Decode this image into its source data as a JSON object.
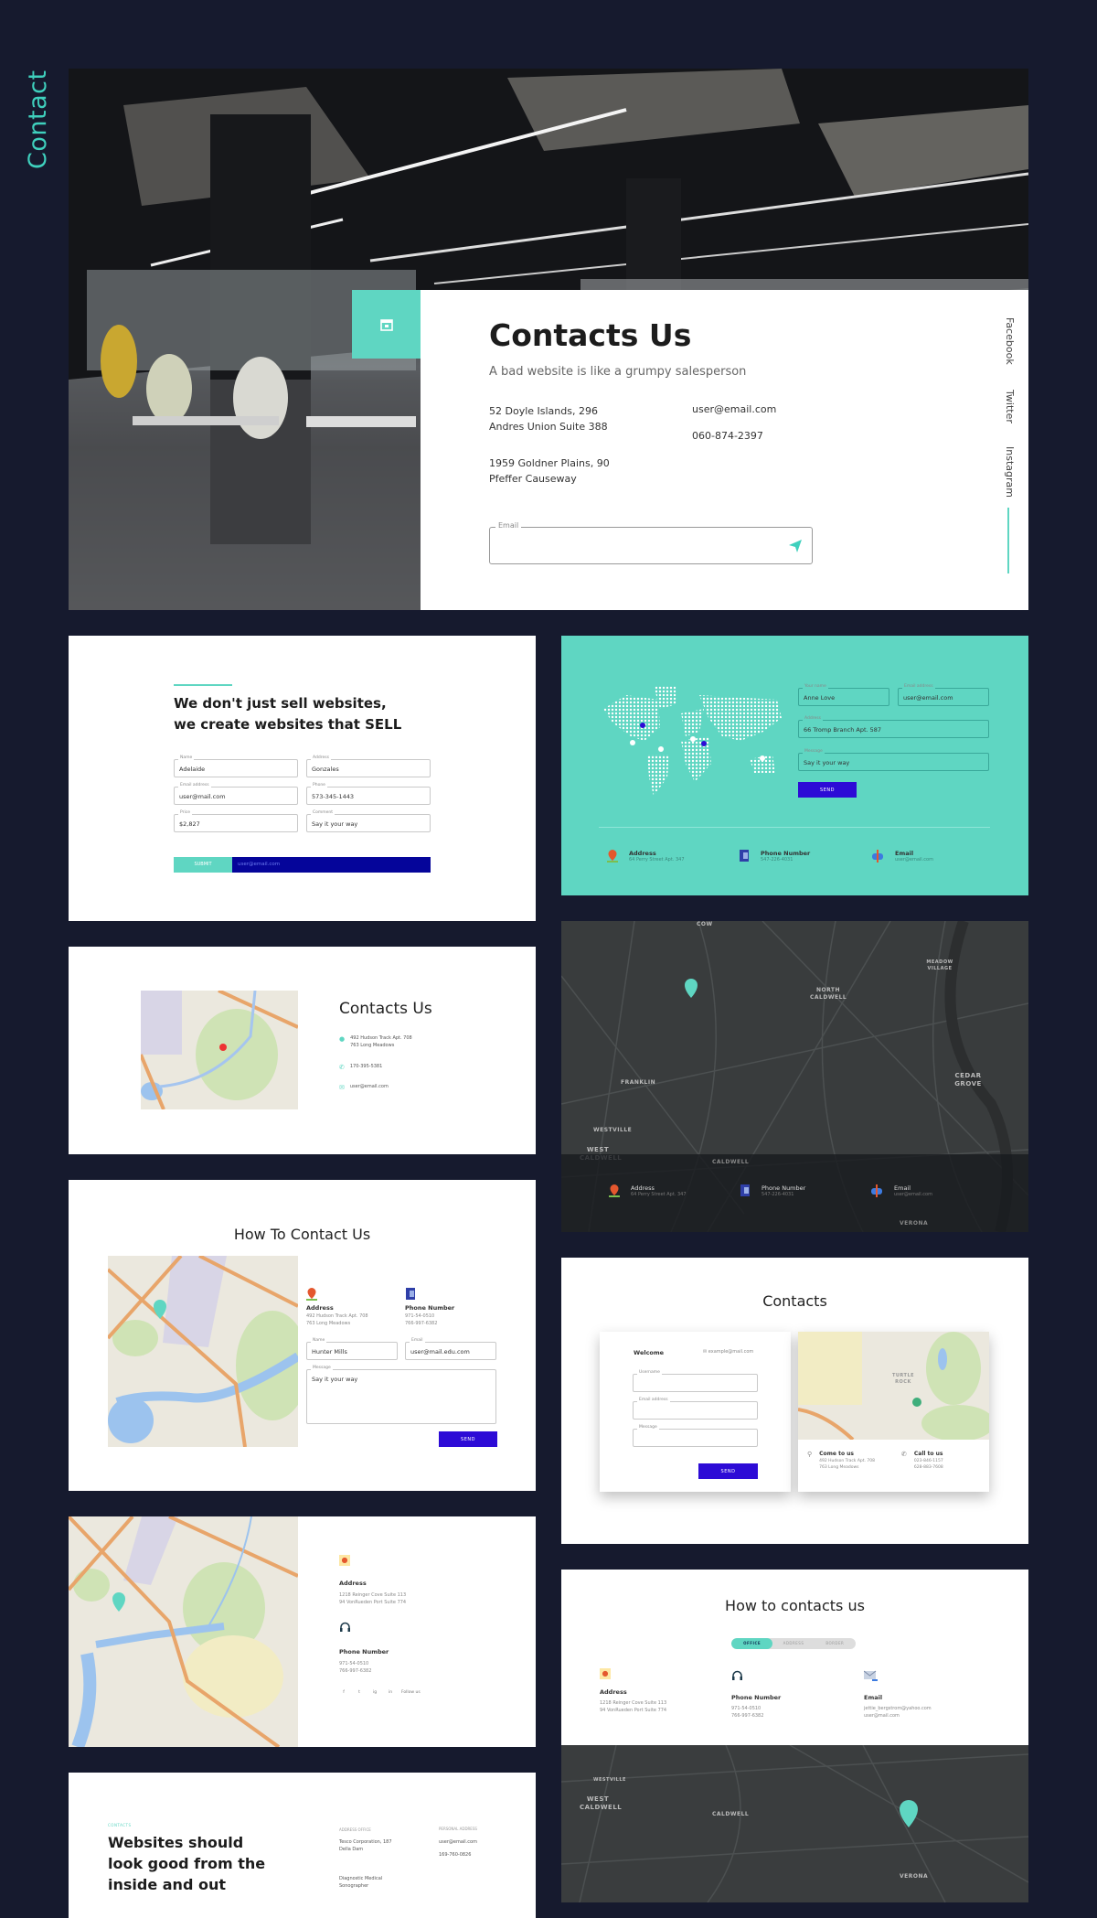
{
  "section_title": "Contact",
  "colors": {
    "background": "#161a2e",
    "accent_teal": "#5fd6c2",
    "button_blue": "#2d0bd6",
    "navy": "#05059a"
  },
  "hero": {
    "icon": "calendar-icon",
    "title": "Contacts Us",
    "subtitle": "A bad website is like a grumpy salesperson",
    "address1": [
      "52 Doyle Islands, 296",
      "Andres Union Suite 388"
    ],
    "address2": [
      "1959 Goldner Plains, 90",
      "Pfeffer Causeway"
    ],
    "email": "user@email.com",
    "phone": "060-874-2397",
    "email_field_label": "Email",
    "send_icon": "paper-plane-icon",
    "social": [
      "Facebook",
      "Twitter",
      "Instagram"
    ]
  },
  "sell": {
    "heading": "We don't just sell websites, we create websites that SELL",
    "fields": [
      {
        "label": "Name",
        "value": "Adelaide"
      },
      {
        "label": "Address",
        "value": "Gonzales"
      },
      {
        "label": "Email address",
        "value": "user@mail.com"
      },
      {
        "label": "Phone",
        "value": "573-345-1443"
      },
      {
        "label": "Price",
        "value": "$2,827"
      },
      {
        "label": "Comment",
        "value": "Say it your way"
      }
    ],
    "submit": "SUBMIT",
    "email_value": "user@email.com"
  },
  "teal": {
    "fields": [
      {
        "label": "Your name",
        "value": "Anne Love"
      },
      {
        "label": "Email address",
        "value": "user@email.com"
      },
      {
        "label": "Address",
        "value": "66 Tromp Branch Apt. 587"
      },
      {
        "label": "Message",
        "value": "Say it your way"
      }
    ],
    "send": "SEND",
    "info": [
      {
        "icon": "map-pin-icon",
        "label": "Address",
        "value": "64 Perry Street Apt. 347"
      },
      {
        "icon": "phone-icon",
        "label": "Phone Number",
        "value": "547-226-4031"
      },
      {
        "icon": "mailbox-icon",
        "label": "Email",
        "value": "user@email.com"
      }
    ]
  },
  "small_contact": {
    "title": "Contacts Us",
    "address": [
      "492 Hudson Track Apt. 708",
      "763 Long Meadows"
    ],
    "phone": "170-395-5381",
    "email": "user@email.com"
  },
  "dark_map": {
    "labels": [
      "COW",
      "NORTH CALDWELL",
      "MEADOW VILLAGE",
      "FRANKLIN",
      "CEDAR GROVE",
      "WESTVILLE",
      "WEST CALDWELL",
      "CALDWELL",
      "VERONA"
    ],
    "info": [
      {
        "icon": "map-pin-icon",
        "label": "Address",
        "value": "64 Perry Street Apt. 347"
      },
      {
        "icon": "phone-icon",
        "label": "Phone Number",
        "value": "547-226-4031"
      },
      {
        "icon": "mailbox-icon",
        "label": "Email",
        "value": "user@email.com"
      }
    ]
  },
  "how_to": {
    "title": "How To Contact Us",
    "address_label": "Address",
    "address": [
      "492 Hudson Track Apt. 708",
      "763 Long Meadows"
    ],
    "phone_label": "Phone Number",
    "phone": [
      "971-54-0510",
      "766-997-6382"
    ],
    "fields": [
      {
        "label": "Name",
        "value": "Hunter Mills"
      },
      {
        "label": "Email",
        "value": "user@mail.edu.com"
      },
      {
        "label": "Message",
        "value": "Say it your way"
      }
    ],
    "send": "SEND"
  },
  "contacts": {
    "title": "Contacts",
    "welcome": "Welcome",
    "email": "example@mail.com",
    "fields": [
      "Username",
      "Email address",
      "Message"
    ],
    "send": "SEND",
    "come_label": "Come to us",
    "come": [
      "492 Hudson Track Apt. 708",
      "763 Long Meadows"
    ],
    "call_label": "Call to us",
    "call": [
      "023-846-1157",
      "628-883-7608"
    ],
    "map_labels": [
      "TURTLE ROCK"
    ]
  },
  "map_info": {
    "address_label": "Address",
    "address": [
      "1218 Reinger Cove Suite 113",
      "94 VonRueden Port Suite 774"
    ],
    "phone_label": "Phone Number",
    "phone": [
      "971-54-0510",
      "766-997-6382"
    ],
    "social": [
      "f",
      "t",
      "ig",
      "in"
    ],
    "follow": "Follow us"
  },
  "how_to2": {
    "title": "How to contacts us",
    "tabs": [
      "OFFICE",
      "ADDRESS",
      "BORDER"
    ],
    "active_tab": "OFFICE",
    "items": [
      {
        "icon": "map-pin-icon",
        "label": "Address",
        "lines": [
          "1218 Reinger Cove Suite 113",
          "94 VonRueden Port Suite 774"
        ]
      },
      {
        "icon": "headset-icon",
        "label": "Phone Number",
        "lines": [
          "971-54-0510",
          "766-997-6382"
        ]
      },
      {
        "icon": "envelope-icon",
        "label": "Email",
        "lines": [
          "jettie_bergstrom@yahoo.com",
          "user@mail.com"
        ]
      }
    ],
    "map_labels": [
      "WESTVILLE",
      "WEST CALDWELL",
      "CALDWELL",
      "VERONA"
    ]
  },
  "websites": {
    "eyebrow": "CONTACTS",
    "heading": "Websites should look good from the inside and out",
    "office_label": "ADDRESS OFFICE",
    "office": [
      "Tesco Corporation, 187",
      "Della Dam"
    ],
    "role": [
      "Diagnostic Medical",
      "Sonographer"
    ],
    "personal_label": "PERSONAL ADDRESS",
    "email": "user@email.com",
    "phone": "169-760-0826"
  }
}
